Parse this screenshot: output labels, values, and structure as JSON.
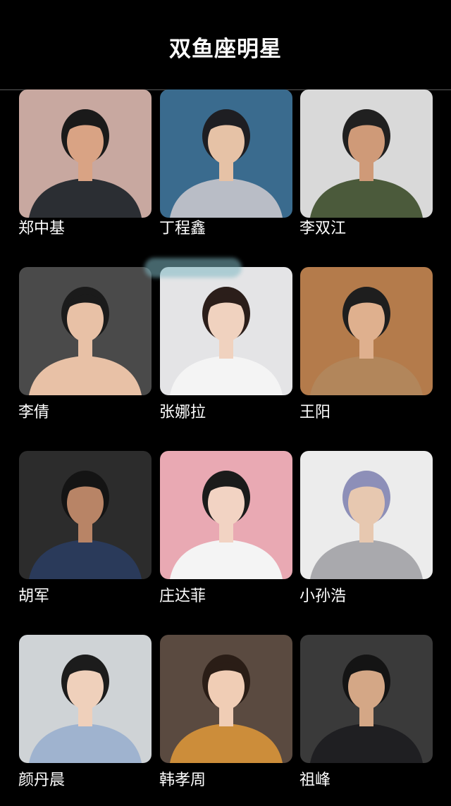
{
  "header": {
    "title": "双鱼座明星"
  },
  "celebrities": [
    {
      "name": "郑中基",
      "bg": "#c8a8a0",
      "skin": "#d9a384",
      "hair": "#1a1a1a",
      "shirt": "#2b2e33"
    },
    {
      "name": "丁程鑫",
      "bg": "#3a6b8e",
      "skin": "#e6c2a6",
      "hair": "#1e1e22",
      "shirt": "#b9bdc6"
    },
    {
      "name": "李双江",
      "bg": "#d9d9d9",
      "skin": "#cf9a78",
      "hair": "#202020",
      "shirt": "#4b5a3b"
    },
    {
      "name": "李倩",
      "bg": "#4a4a4a",
      "skin": "#e8c1a6",
      "hair": "#1b1b1b",
      "shirt": "#e8c1a6"
    },
    {
      "name": "张娜拉",
      "bg": "#e4e4e6",
      "skin": "#f0d2bf",
      "hair": "#2b1e1a",
      "shirt": "#f4f4f4"
    },
    {
      "name": "王阳",
      "bg": "#b47b4b",
      "skin": "#dfb08e",
      "hair": "#1e1e1e",
      "shirt": "#b2865b"
    },
    {
      "name": "胡军",
      "bg": "#2c2c2c",
      "skin": "#b88466",
      "hair": "#141414",
      "shirt": "#2a3a5a"
    },
    {
      "name": "庄达菲",
      "bg": "#e9a9b3",
      "skin": "#f2d3c3",
      "hair": "#1b1b1b",
      "shirt": "#f4f4f4"
    },
    {
      "name": "小孙浩",
      "bg": "#ececec",
      "skin": "#e7c8b0",
      "hair": "#8d8fb8",
      "shirt": "#a9a9ad"
    },
    {
      "name": "颜丹晨",
      "bg": "#cfd3d6",
      "skin": "#efd0bb",
      "hair": "#1c1c1c",
      "shirt": "#9fb3cf"
    },
    {
      "name": "韩孝周",
      "bg": "#5a4a40",
      "skin": "#f0cdb5",
      "hair": "#2a1d16",
      "shirt": "#cc8d3a"
    },
    {
      "name": "祖峰",
      "bg": "#3a3a3a",
      "skin": "#d4a786",
      "hair": "#141414",
      "shirt": "#1f1f22"
    }
  ],
  "colors": {
    "background": "#000000",
    "text": "#ffffff",
    "divider": "#5a5a5a"
  }
}
